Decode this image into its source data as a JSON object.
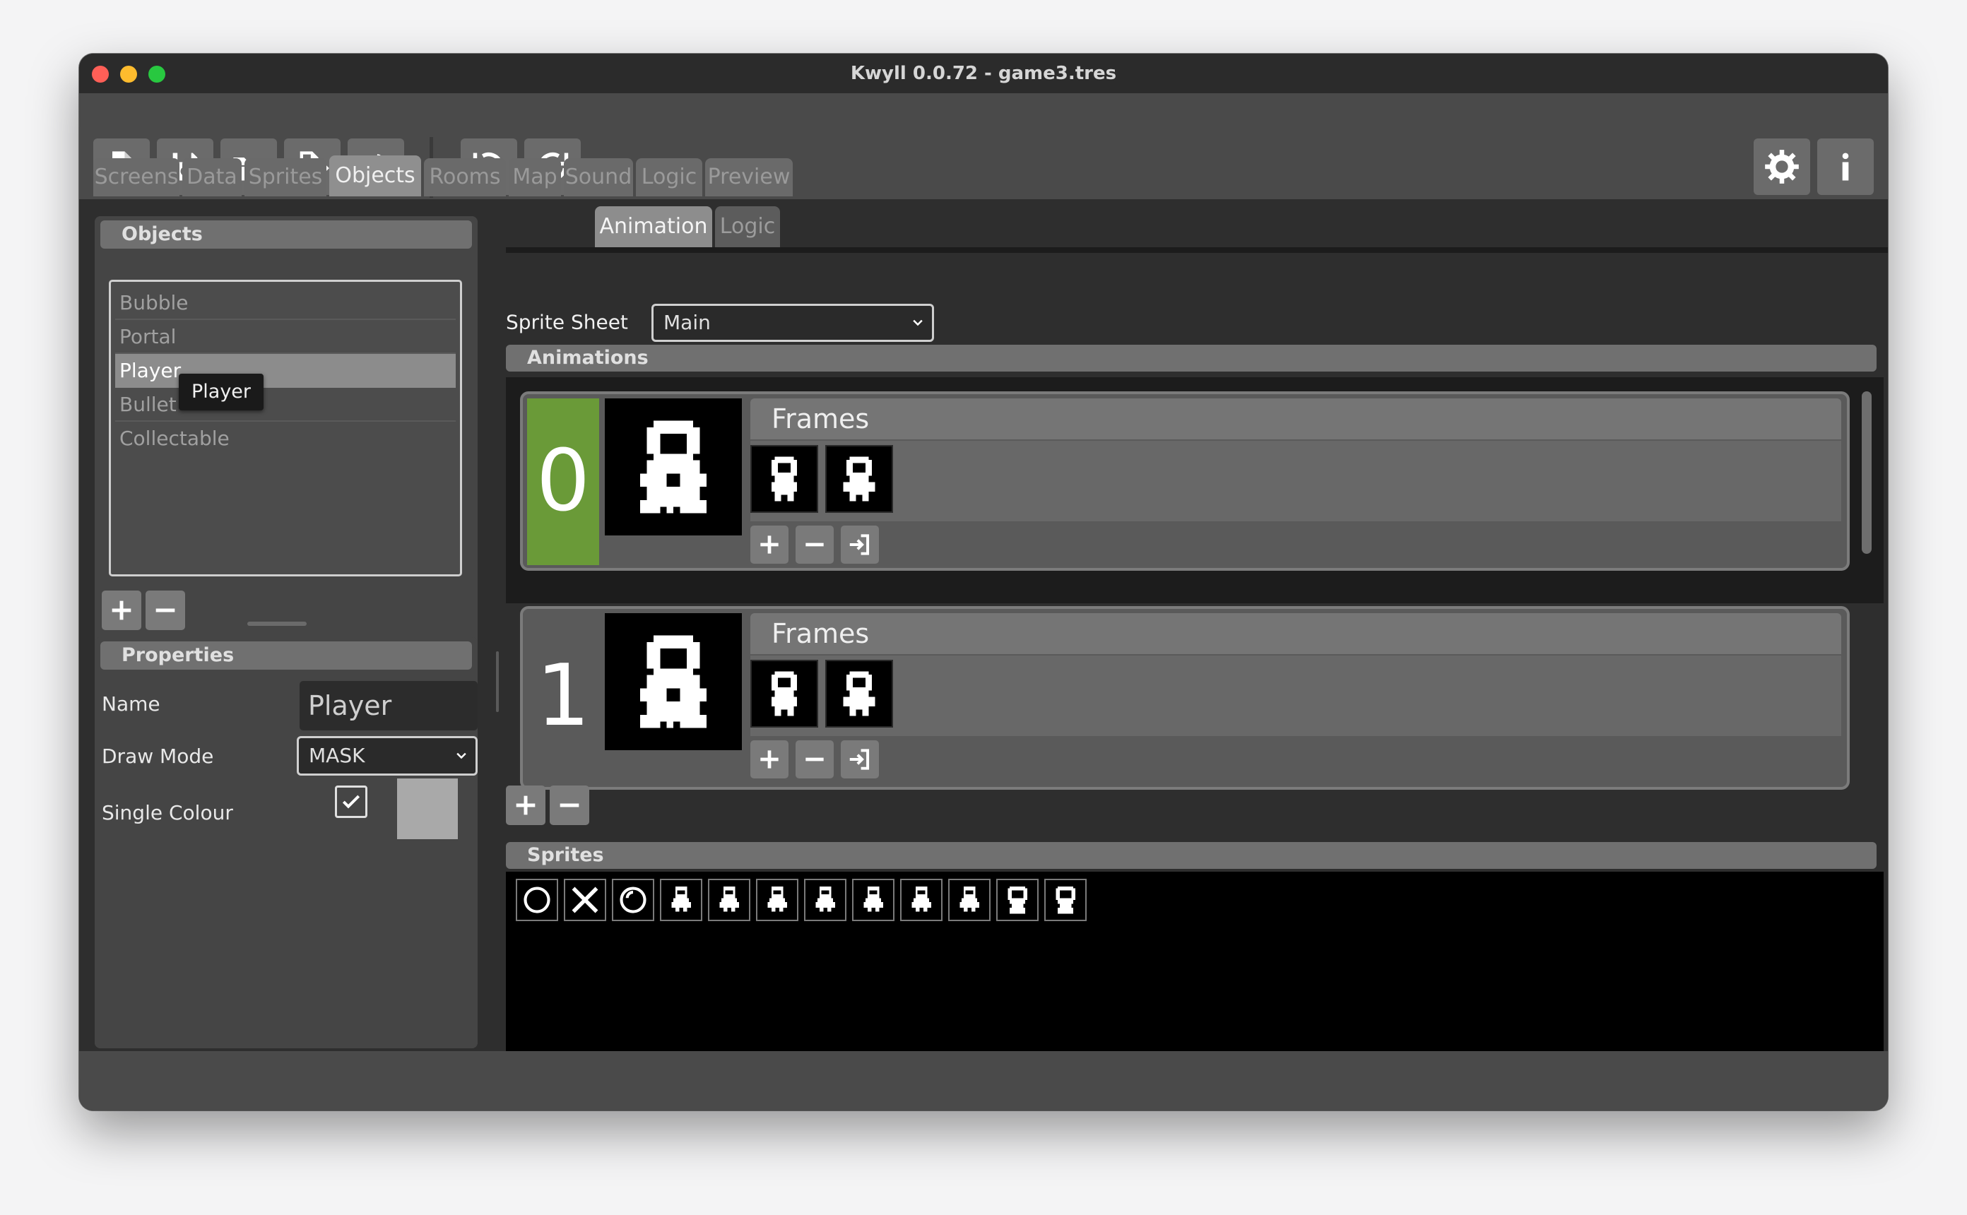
{
  "window": {
    "title": "Kwyll 0.0.72 - game3.tres"
  },
  "toolbar": {
    "buttons": [
      "new-file-icon",
      "save-icon",
      "open-folder-icon",
      "export-icon",
      "code-icon",
      "undo-icon",
      "redo-icon",
      "settings-icon",
      "info-icon"
    ]
  },
  "main_tabs": [
    "Screens",
    "Data",
    "Sprites",
    "Objects",
    "Rooms",
    "Map",
    "Sound",
    "Logic",
    "Preview"
  ],
  "active_main_tab": "Objects",
  "objects_panel": {
    "header": "Objects",
    "items": [
      "Bubble",
      "Portal",
      "Player",
      "Bullet",
      "Collectable"
    ],
    "selected": "Player",
    "tooltip": "Player"
  },
  "properties": {
    "header": "Properties",
    "name_label": "Name",
    "name_value": "Player",
    "draw_mode_label": "Draw Mode",
    "draw_mode_value": "MASK",
    "single_colour_label": "Single Colour",
    "single_colour_checked": true,
    "single_colour_swatch": "#a9a9a9"
  },
  "sub_tabs": [
    "Animation",
    "Logic"
  ],
  "active_sub_tab": "Animation",
  "sprite_sheet": {
    "label": "Sprite Sheet",
    "value": "Main"
  },
  "animations": {
    "header": "Animations",
    "items": [
      {
        "index": "0",
        "frames_label": "Frames",
        "frame_count": 2,
        "highlight_color": "#6a9a38"
      },
      {
        "index": "1",
        "frames_label": "Frames",
        "frame_count": 2
      }
    ]
  },
  "sprites": {
    "header": "Sprites",
    "count": 12
  },
  "colors": {
    "accent_green": "#6a9a38",
    "panel": "#454545",
    "background": "#2e2e2e"
  }
}
